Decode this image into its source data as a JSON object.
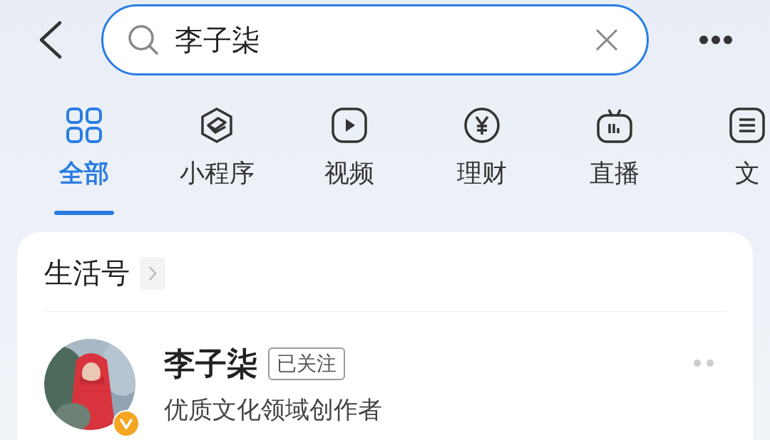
{
  "search": {
    "value": "李子柒"
  },
  "tabs": [
    {
      "label": "全部",
      "kind": "all",
      "selected": true
    },
    {
      "label": "小程序",
      "kind": "miniapp",
      "selected": false
    },
    {
      "label": "视频",
      "kind": "video",
      "selected": false
    },
    {
      "label": "理财",
      "kind": "finance",
      "selected": false
    },
    {
      "label": "直播",
      "kind": "live",
      "selected": false
    },
    {
      "label": "文",
      "kind": "article",
      "selected": false
    }
  ],
  "section": {
    "title": "生活号",
    "accounts": [
      {
        "name": "李子柒",
        "tag": "已关注",
        "description": "优质文化领域创作者",
        "verified": true
      }
    ]
  }
}
